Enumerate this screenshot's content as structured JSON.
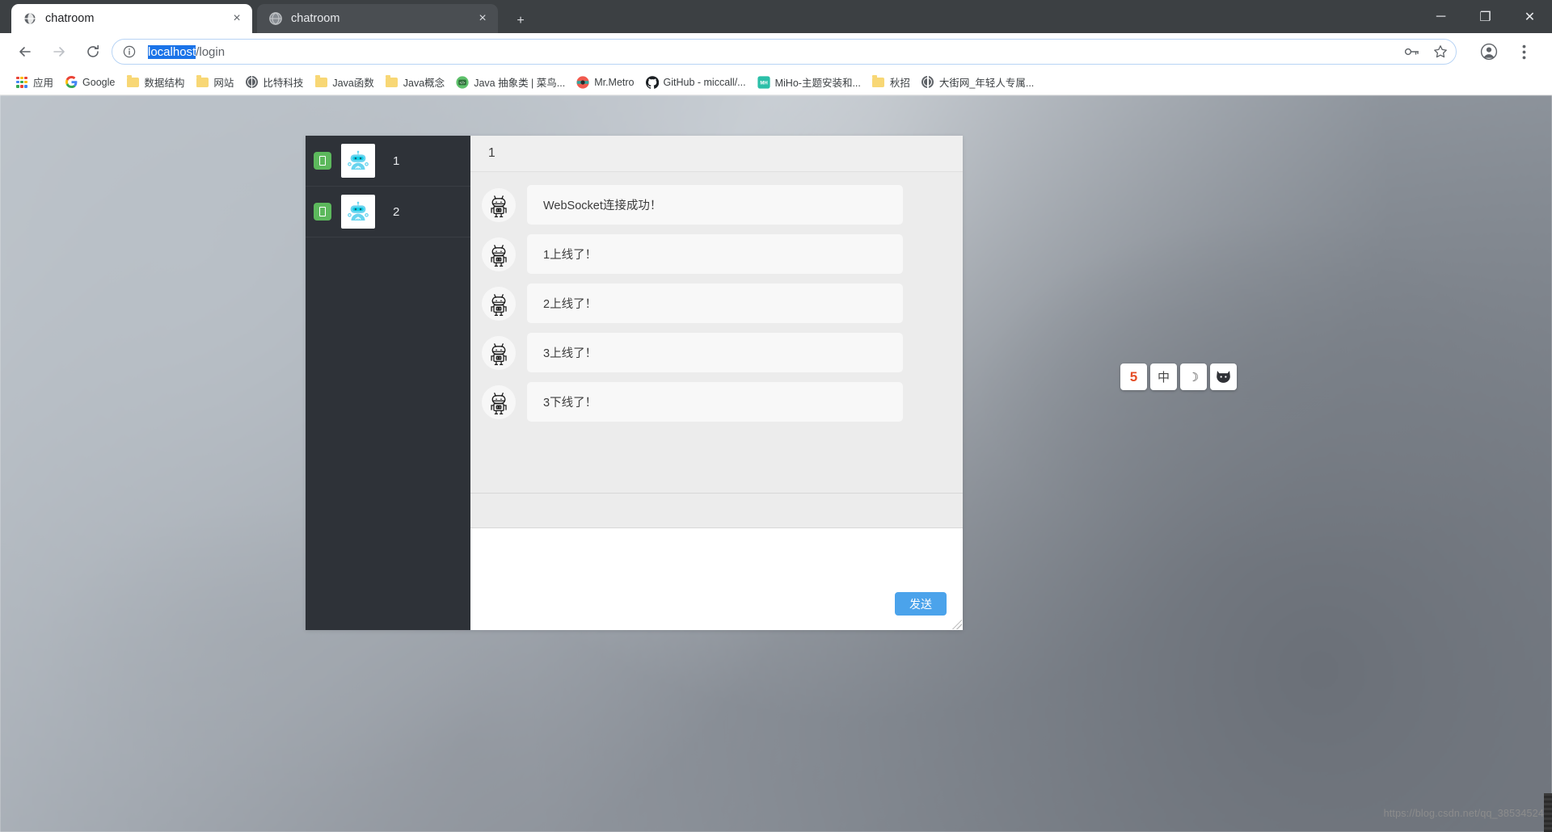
{
  "browser": {
    "tabs": [
      {
        "title": "chatroom",
        "active": true,
        "favicon": "globe-icon",
        "close_label": "×"
      },
      {
        "title": "chatroom",
        "active": false,
        "favicon": "globe-icon",
        "close_label": "×"
      }
    ],
    "new_tab_label": "+",
    "window_controls": {
      "minimize": "─",
      "maximize": "❐",
      "close": "✕"
    },
    "nav": {
      "back": "←",
      "forward": "→",
      "reload": "⟳"
    },
    "omnibox": {
      "info_icon": "info-circle-icon",
      "url_selected": "localhost",
      "url_rest": "/login",
      "full_url": "localhost/login",
      "key_icon": "key-icon",
      "star_icon": "star-icon"
    },
    "profile_icon": "profile-avatar-icon",
    "menu_icon": "three-dot-menu-icon",
    "bookmarks": [
      {
        "label": "应用",
        "icon": "apps-grid-icon"
      },
      {
        "label": "Google",
        "icon": "google-icon"
      },
      {
        "label": "数据结构",
        "icon": "folder-icon"
      },
      {
        "label": "网站",
        "icon": "folder-icon"
      },
      {
        "label": "比特科技",
        "icon": "globe-icon"
      },
      {
        "label": "Java函数",
        "icon": "folder-icon"
      },
      {
        "label": "Java概念",
        "icon": "folder-icon"
      },
      {
        "label": "Java 抽象类 | 菜鸟...",
        "icon": "runoob-icon"
      },
      {
        "label": "Mr.Metro",
        "icon": "metro-icon"
      },
      {
        "label": "GitHub - miccall/...",
        "icon": "github-icon"
      },
      {
        "label": "MiHo-主题安装和...",
        "icon": "miho-icon"
      },
      {
        "label": "秋招",
        "icon": "folder-icon"
      },
      {
        "label": "大街网_年轻人专属...",
        "icon": "globe-icon"
      }
    ]
  },
  "chat": {
    "sidebar": {
      "users": [
        {
          "name": "1",
          "status": "online",
          "avatar": "robot-avatar-icon"
        },
        {
          "name": "2",
          "status": "online",
          "avatar": "robot-avatar-icon"
        }
      ]
    },
    "header": {
      "title": "1"
    },
    "messages": [
      {
        "avatar": "robot-avatar-icon",
        "text": "WebSocket连接成功！"
      },
      {
        "avatar": "robot-avatar-icon",
        "text": "1上线了！"
      },
      {
        "avatar": "robot-avatar-icon",
        "text": "2上线了！"
      },
      {
        "avatar": "robot-avatar-icon",
        "text": "3上线了！"
      },
      {
        "avatar": "robot-avatar-icon",
        "text": "3下线了！"
      }
    ],
    "compose": {
      "value": "",
      "placeholder": ""
    },
    "send_button": {
      "label": "发送",
      "color": "#4ba3eb"
    }
  },
  "float_toolbar": [
    {
      "name": "html5-logo-icon",
      "glyph": "5"
    },
    {
      "name": "ime-chinese-icon",
      "glyph": "中"
    },
    {
      "name": "moon-icon",
      "glyph": "☽"
    },
    {
      "name": "fox-icon",
      "glyph": "ᾘA"
    }
  ],
  "watermark": {
    "text": "https://blog.csdn.net/qq_38534524"
  }
}
